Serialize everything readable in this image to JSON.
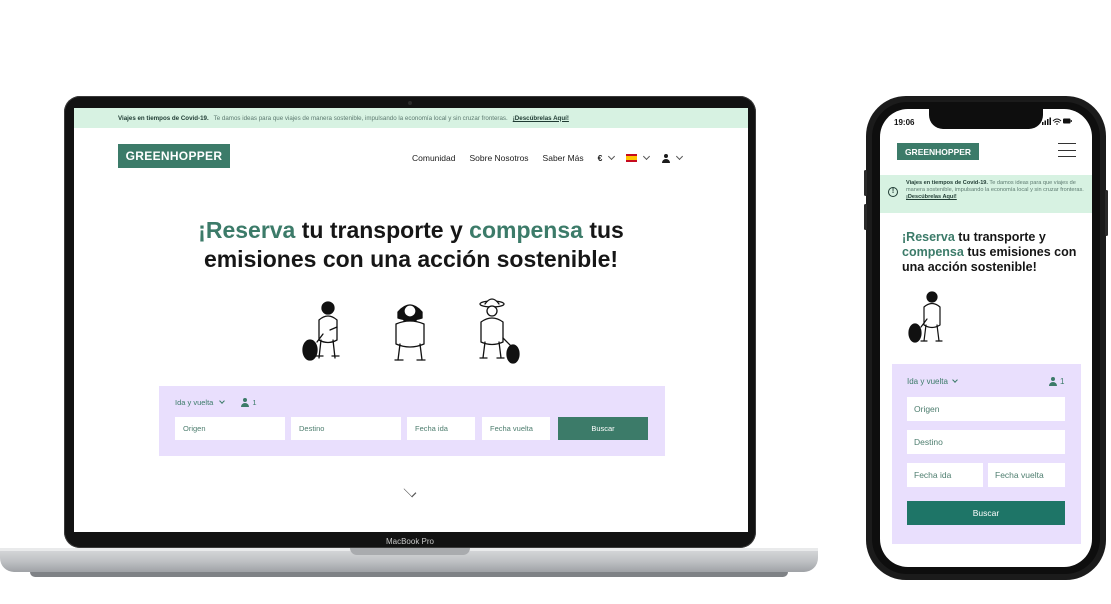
{
  "laptop": {
    "brand_label": "MacBook Pro",
    "banner": {
      "title": "Viajes en tiempos de Covid-19.",
      "message": "Te damos ideas para que viajes de manera sostenible, impulsando la economía local y sin cruzar fronteras.",
      "link": "¡Descúbrelas Aquí!"
    },
    "logo": "GREENHOPPER",
    "nav": {
      "items": [
        "Comunidad",
        "Sobre Nosotros",
        "Saber Más"
      ],
      "currency": "€"
    },
    "hero": {
      "part1": "¡Reserva",
      "part2": " tu transporte y ",
      "part3": "compensa",
      "part4": " tus emisiones con una acción sostenible!"
    },
    "search": {
      "trip_type": "Ida y vuelta",
      "passengers": "1",
      "origin_placeholder": "Origen",
      "destination_placeholder": "Destino",
      "date_out_placeholder": "Fecha ida",
      "date_back_placeholder": "Fecha vuelta",
      "submit_label": "Buscar"
    },
    "icons": [
      "chevron-down-icon",
      "spain-flag-icon",
      "user-icon",
      "scroll-down-icon"
    ]
  },
  "phone": {
    "status_time": "19:06",
    "logo": "GREENHOPPER",
    "banner": {
      "title": "Viajes en tiempos de Covid-19.",
      "message": " Te damos ideas para que viajes de manera sostenible, impulsando la economía local y sin cruzar fronteras. ",
      "link": "¡Descúbrelas Aquí!"
    },
    "hero": {
      "part1": "¡Reserva",
      "part2": " tu transporte y ",
      "part3": "compensa",
      "part4": " tus emisiones con una acción sostenible!"
    },
    "search": {
      "trip_type": "Ida y vuelta",
      "passengers": "1",
      "origin_placeholder": "Origen",
      "destination_placeholder": "Destino",
      "date_out_placeholder": "Fecha ida",
      "date_back_placeholder": "Fecha vuelta",
      "submit_label": "Buscar"
    }
  },
  "colors": {
    "brand_green": "#3c7b69",
    "banner_mint": "#d7f2e2",
    "search_lavender": "#e9dffd",
    "button_teal": "#1e7567"
  }
}
